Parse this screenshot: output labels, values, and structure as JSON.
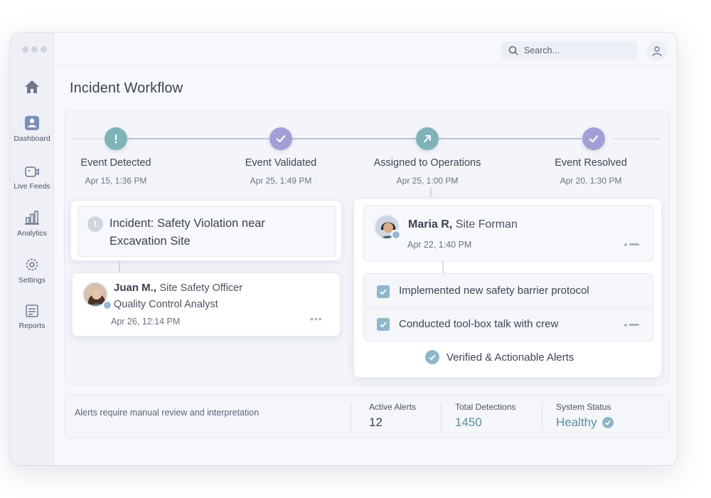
{
  "window": {
    "search": {
      "placeholder": "Search..."
    }
  },
  "sidebar": {
    "items": [
      {
        "label": "",
        "icon": "home-icon"
      },
      {
        "label": "Dashboard",
        "icon": "dashboard-icon",
        "active": true
      },
      {
        "label": "Live Feeds",
        "icon": "camera-icon"
      },
      {
        "label": "Analytics",
        "icon": "analytics-icon"
      },
      {
        "label": "Settings",
        "icon": "gear-icon"
      },
      {
        "label": "Reports",
        "icon": "reports-icon"
      }
    ]
  },
  "page": {
    "title": "Incident Workflow"
  },
  "timeline": {
    "steps": [
      {
        "title": "Event Detected",
        "date": "Apr 15, 1:36 PM",
        "icon": "exclamation-icon",
        "color": "#7fb3b8"
      },
      {
        "title": "Event Validated",
        "date": "Apr 25, 1:49 PM",
        "icon": "check-icon",
        "color": "#a39fd6"
      },
      {
        "title": "Assigned to Operations",
        "date": "Apr 25, 1:00 PM",
        "icon": "arrow-icon",
        "color": "#7fb3b8"
      },
      {
        "title": "Event Resolved",
        "date": "Apr 20, 1:30 PM",
        "icon": "check-icon",
        "color": "#a39fd6"
      }
    ]
  },
  "incident": {
    "title_line1": "Incident: Safety Violation near",
    "title_line2": "Excavation Site"
  },
  "officer": {
    "name": "Juan M.,",
    "role": "Site Safety Officer",
    "role2": "Quality Control Analyst",
    "date": "Apr 26, 12:14 PM"
  },
  "foreman": {
    "name": "Maria R,",
    "role": "Site Forman",
    "date": "Apr 22, 1:40 PM"
  },
  "tasks": [
    {
      "label": "Implemented new safety barrier protocol",
      "checked": true
    },
    {
      "label": "Conducted tool-box talk with crew",
      "checked": true
    }
  ],
  "verified": {
    "label": "Verified & Actionable Alerts"
  },
  "footer": {
    "note": "Alerts require manual review and interpretation",
    "stats": [
      {
        "label": "Active Alerts",
        "value": "12"
      },
      {
        "label": "Total Detections",
        "value": "1450"
      },
      {
        "label": "System Status",
        "value": "Healthy"
      }
    ]
  },
  "colors": {
    "teal": "#7fb3b8",
    "purple": "#a39fd6",
    "accent_text": "#5b8fa0"
  }
}
